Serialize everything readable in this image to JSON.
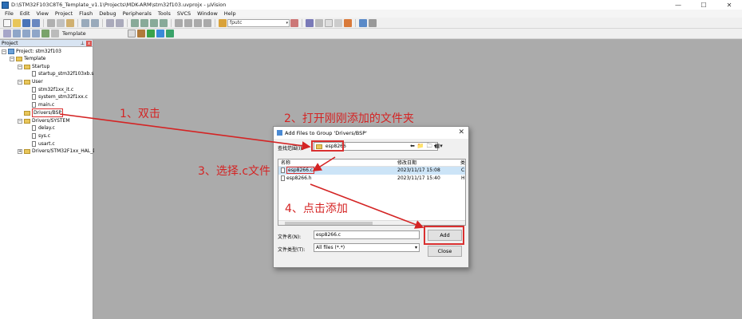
{
  "window": {
    "title": "D:\\STM32F103C8T6_Template_v1.1\\Projects\\MDK-ARM\\stm32f103.uvprojx - µVision",
    "controls": [
      "—",
      "☐",
      "✕"
    ]
  },
  "menu": [
    "File",
    "Edit",
    "View",
    "Project",
    "Flash",
    "Debug",
    "Peripherals",
    "Tools",
    "SVCS",
    "Window",
    "Help"
  ],
  "toolbar": {
    "search_value": "fputc",
    "target_value": "Template"
  },
  "project_panel": {
    "header": "Project",
    "pin": "⊥",
    "close": "x",
    "tree": [
      {
        "label": "Project: stm32f103",
        "kind": "project",
        "exp": "−"
      },
      {
        "label": "Template",
        "kind": "folder",
        "exp": "−"
      },
      {
        "label": "Startup",
        "kind": "folder",
        "exp": "−"
      },
      {
        "label": "startup_stm32f103xb.s",
        "kind": "file",
        "exp": ""
      },
      {
        "label": "User",
        "kind": "folder",
        "exp": "−"
      },
      {
        "label": "stm32f1xx_it.c",
        "kind": "file",
        "exp": ""
      },
      {
        "label": "system_stm32f1xx.c",
        "kind": "file",
        "exp": ""
      },
      {
        "label": "main.c",
        "kind": "file",
        "exp": ""
      },
      {
        "label": "Drivers/BSP",
        "kind": "folder",
        "exp": ""
      },
      {
        "label": "Drivers/SYSTEM",
        "kind": "folder",
        "exp": "−"
      },
      {
        "label": "delay.c",
        "kind": "file",
        "exp": ""
      },
      {
        "label": "sys.c",
        "kind": "file",
        "exp": ""
      },
      {
        "label": "usart.c",
        "kind": "file",
        "exp": ""
      },
      {
        "label": "Drivers/STM32F1xx_HAL_Dri",
        "kind": "folder",
        "exp": "+"
      }
    ]
  },
  "dialog": {
    "title": "Add Files to Group 'Drivers/BSP'",
    "close": "✕",
    "look_in_label": "查找范围(I):",
    "look_in_value": "esp8266",
    "columns": [
      "名称",
      "修改日期",
      "类"
    ],
    "files": [
      {
        "name": "esp8266.c",
        "date": "2023/11/17 15:08",
        "type": "C",
        "selected": true
      },
      {
        "name": "esp8266.h",
        "date": "2023/11/17 15:40",
        "type": "H",
        "selected": false
      }
    ],
    "filename_label": "文件名(N):",
    "filename_value": "esp8266.c",
    "filetype_label": "文件类型(T):",
    "filetype_value": "All files (*.*)",
    "add_button": "Add",
    "close_button": "Close"
  },
  "annotations": {
    "step1": "1、双击",
    "step2": "2、打开刚刚添加的文件夹",
    "step3": "3、选择.c文件",
    "step4": "4、点击添加"
  },
  "colors": {
    "annotation": "#d42424",
    "workspace": "#ababab",
    "selection": "#cce4f7"
  }
}
